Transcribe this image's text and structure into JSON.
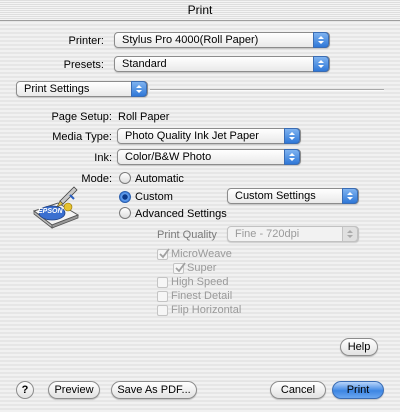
{
  "window": {
    "title": "Print"
  },
  "printer": {
    "label": "Printer:",
    "value": "Stylus Pro 4000(Roll Paper)"
  },
  "presets": {
    "label": "Presets:",
    "value": "Standard"
  },
  "panel": {
    "value": "Print Settings"
  },
  "page_setup": {
    "label": "Page Setup:",
    "value": "Roll Paper"
  },
  "media_type": {
    "label": "Media Type:",
    "value": "Photo Quality Ink Jet Paper"
  },
  "ink": {
    "label": "Ink:",
    "value": "Color/B&W Photo"
  },
  "mode": {
    "label": "Mode:",
    "options": [
      "Automatic",
      "Custom",
      "Advanced Settings"
    ],
    "selected": "Custom",
    "custom_settings": "Custom Settings"
  },
  "logo": {
    "text": "EPSON"
  },
  "print_quality": {
    "label": "Print Quality",
    "value": "Fine - 720dpi"
  },
  "checkboxes": {
    "microweave": {
      "label": "MicroWeave",
      "checked": true
    },
    "super": {
      "label": "Super",
      "checked": true
    },
    "high_speed": {
      "label": "High Speed",
      "checked": false
    },
    "finest_detail": {
      "label": "Finest Detail",
      "checked": false
    },
    "flip_horizontal": {
      "label": "Flip Horizontal",
      "checked": false
    }
  },
  "buttons": {
    "help": "Help",
    "question": "?",
    "preview": "Preview",
    "save_pdf": "Save As PDF...",
    "cancel": "Cancel",
    "print": "Print"
  },
  "colors": {
    "accent": "#3d86e3",
    "disabled": "#9a9a9a"
  }
}
